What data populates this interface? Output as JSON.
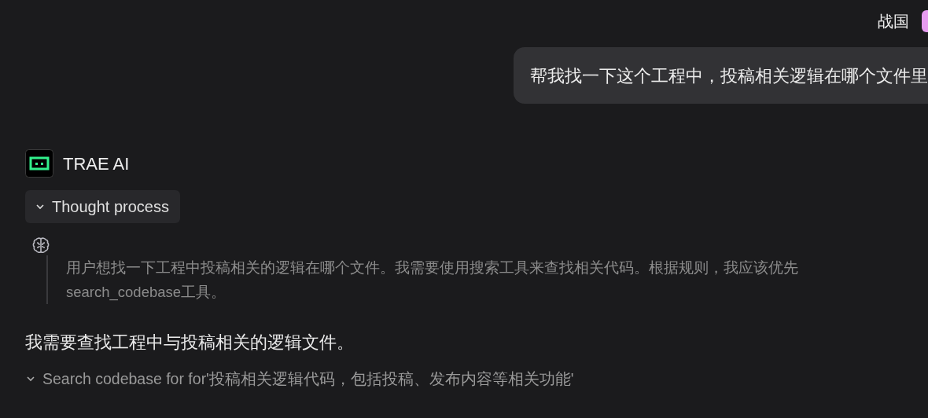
{
  "header": {
    "user_name": "战国"
  },
  "user_message": {
    "text": "帮我找一下这个工程中，投稿相关逻辑在哪个文件里"
  },
  "assistant": {
    "name": "TRAE AI"
  },
  "thought": {
    "label": "Thought process",
    "expanded": true,
    "lines": [
      "用户想找一下工程中投稿相关的逻辑在哪个文件。我需要使用搜索工具来查找相关代码。根据规则，我应该优先",
      "search_codebase工具。"
    ]
  },
  "reply": "我需要查找工程中与投稿相关的逻辑文件。",
  "tool_call": {
    "label": "Search codebase for for'投稿相关逻辑代码，包括投稿、发布内容等相关功能'",
    "expanded": true
  }
}
